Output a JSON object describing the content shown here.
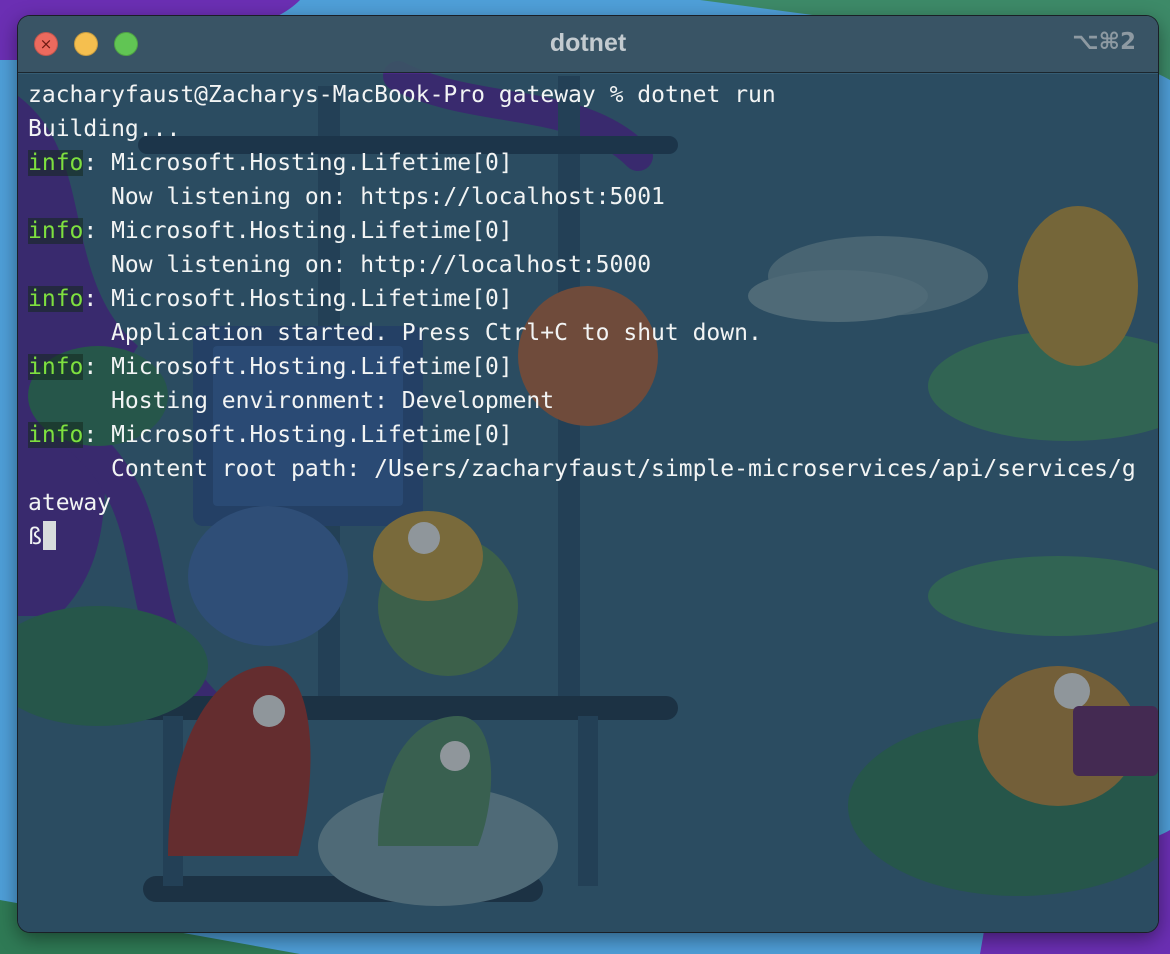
{
  "window": {
    "title": "dotnet",
    "shortcut": "⌥⌘2",
    "close_glyph": "×"
  },
  "terminal": {
    "prompt_line": "zacharyfaust@Zacharys-MacBook-Pro gateway % dotnet run",
    "building": "Building...",
    "info_tag": "info",
    "logs": [
      {
        "source": ": Microsoft.Hosting.Lifetime[0]",
        "message": "Now listening on: https://localhost:5001"
      },
      {
        "source": ": Microsoft.Hosting.Lifetime[0]",
        "message": "Now listening on: http://localhost:5000"
      },
      {
        "source": ": Microsoft.Hosting.Lifetime[0]",
        "message": "Application started. Press Ctrl+C to shut down."
      },
      {
        "source": ": Microsoft.Hosting.Lifetime[0]",
        "message": "Hosting environment: Development"
      },
      {
        "source": ": Microsoft.Hosting.Lifetime[0]",
        "message": "Content root path: /Users/zacharyfaust/simple-microservices/api/services/g"
      }
    ],
    "wrapped_line": "ateway",
    "input_text": "ß"
  },
  "colors": {
    "info_green": "#7ee03f",
    "text": "#f2f4f4",
    "close": "#ed6a5e",
    "minimize": "#f5bf4f",
    "zoom": "#61c554"
  }
}
